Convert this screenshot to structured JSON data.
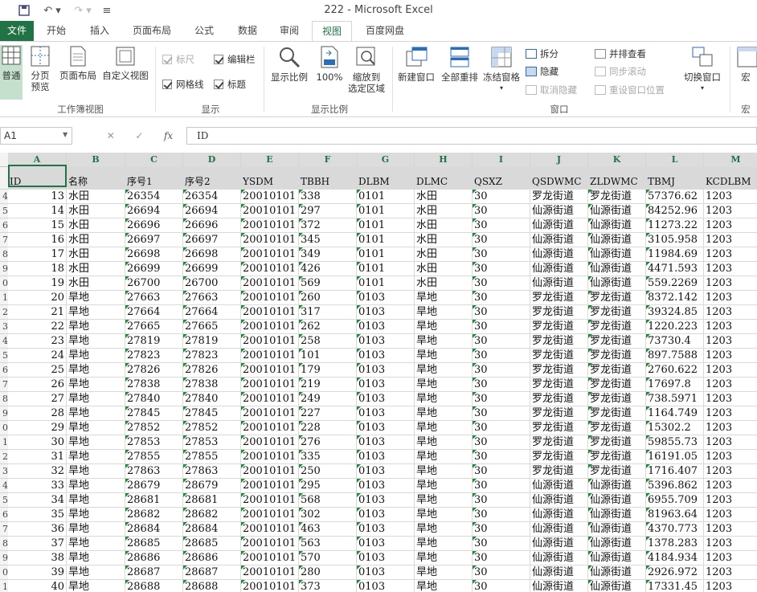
{
  "window": {
    "title": "222 - Microsoft Excel"
  },
  "quick_access": {
    "save_icon": "save-icon",
    "undo_icon": "undo-icon",
    "redo_icon": "redo-icon",
    "customize_icon": "customize-icon"
  },
  "tabs": [
    {
      "label": "文件"
    },
    {
      "label": "开始"
    },
    {
      "label": "插入"
    },
    {
      "label": "页面布局"
    },
    {
      "label": "公式"
    },
    {
      "label": "数据"
    },
    {
      "label": "审阅"
    },
    {
      "label": "视图"
    },
    {
      "label": "百度网盘"
    }
  ],
  "ribbon": {
    "normal": "普通",
    "page_break": "分页\n预览",
    "page_layout": "页面布局",
    "custom_view": "自定义视图",
    "group_workbook_views": "工作簿视图",
    "ruler": "标尺",
    "formula_bar": "编辑栏",
    "gridlines": "网格线",
    "headings": "标题",
    "group_show": "显示",
    "zoom": "显示比例",
    "zoom100": "100%",
    "zoom_selection": "缩放到\n选定区域",
    "group_zoom": "显示比例",
    "new_window": "新建窗口",
    "arrange_all": "全部重排",
    "freeze_panes": "冻结窗格",
    "split": "拆分",
    "hide": "隐藏",
    "unhide": "取消隐藏",
    "side_by_side": "并排查看",
    "sync_scroll": "同步滚动",
    "reset_position": "重设窗口位置",
    "switch_windows": "切换窗口",
    "group_window": "窗口",
    "macros": "宏",
    "group_macros": "宏"
  },
  "formula_bar": {
    "name_box": "A1",
    "fx": "fx",
    "value": "ID"
  },
  "columns": [
    "A",
    "B",
    "C",
    "D",
    "E",
    "F",
    "G",
    "H",
    "I",
    "J",
    "K",
    "L",
    "M"
  ],
  "header_row": [
    "ID",
    "名称",
    "序号1",
    "序号2",
    "YSDM",
    "TBBH",
    "DLBM",
    "DLMC",
    "QSXZ",
    "QSDWMC",
    "ZLDWMC",
    "TBMJ",
    "KCDLBM"
  ],
  "row_numbers": [
    "",
    "4",
    "5",
    "6",
    "7",
    "8",
    "9",
    "0",
    "1",
    "2",
    "3",
    "4",
    "5",
    "6",
    "7",
    "8",
    "9",
    "0",
    "1",
    "2",
    "3",
    "4",
    "5",
    "6",
    "7",
    "8",
    "9",
    "0",
    "1"
  ],
  "rows": [
    [
      "13",
      "水田",
      "26354",
      "26354",
      "20010101",
      "338",
      "0101",
      "水田",
      "30",
      "罗龙街道",
      "罗龙街道",
      "57376.62",
      "1203"
    ],
    [
      "14",
      "水田",
      "26694",
      "26694",
      "20010101",
      "297",
      "0101",
      "水田",
      "30",
      "仙源街道",
      "仙源街道",
      "84252.96",
      "1203"
    ],
    [
      "15",
      "水田",
      "26696",
      "26696",
      "20010101",
      "372",
      "0101",
      "水田",
      "30",
      "仙源街道",
      "仙源街道",
      "11273.22",
      "1203"
    ],
    [
      "16",
      "水田",
      "26697",
      "26697",
      "20010101",
      "345",
      "0101",
      "水田",
      "30",
      "仙源街道",
      "仙源街道",
      "3105.958",
      "1203"
    ],
    [
      "17",
      "水田",
      "26698",
      "26698",
      "20010101",
      "349",
      "0101",
      "水田",
      "30",
      "仙源街道",
      "仙源街道",
      "11984.69",
      "1203"
    ],
    [
      "18",
      "水田",
      "26699",
      "26699",
      "20010101",
      "426",
      "0101",
      "水田",
      "30",
      "仙源街道",
      "仙源街道",
      "4471.593",
      "1203"
    ],
    [
      "19",
      "水田",
      "26700",
      "26700",
      "20010101",
      "569",
      "0101",
      "水田",
      "30",
      "仙源街道",
      "仙源街道",
      "559.2269",
      "1203"
    ],
    [
      "20",
      "旱地",
      "27663",
      "27663",
      "20010101",
      "260",
      "0103",
      "旱地",
      "30",
      "罗龙街道",
      "罗龙街道",
      "8372.142",
      "1203"
    ],
    [
      "21",
      "旱地",
      "27664",
      "27664",
      "20010101",
      "317",
      "0103",
      "旱地",
      "30",
      "罗龙街道",
      "罗龙街道",
      "39324.85",
      "1203"
    ],
    [
      "22",
      "旱地",
      "27665",
      "27665",
      "20010101",
      "262",
      "0103",
      "旱地",
      "30",
      "罗龙街道",
      "罗龙街道",
      "1220.223",
      "1203"
    ],
    [
      "23",
      "旱地",
      "27819",
      "27819",
      "20010101",
      "258",
      "0103",
      "旱地",
      "30",
      "罗龙街道",
      "罗龙街道",
      "73730.4",
      "1203"
    ],
    [
      "24",
      "旱地",
      "27823",
      "27823",
      "20010101",
      "101",
      "0103",
      "旱地",
      "30",
      "罗龙街道",
      "罗龙街道",
      "897.7588",
      "1203"
    ],
    [
      "25",
      "旱地",
      "27826",
      "27826",
      "20010101",
      "179",
      "0103",
      "旱地",
      "30",
      "罗龙街道",
      "罗龙街道",
      "2760.622",
      "1203"
    ],
    [
      "26",
      "旱地",
      "27838",
      "27838",
      "20010101",
      "219",
      "0103",
      "旱地",
      "30",
      "罗龙街道",
      "罗龙街道",
      "17697.8",
      "1203"
    ],
    [
      "27",
      "旱地",
      "27840",
      "27840",
      "20010101",
      "249",
      "0103",
      "旱地",
      "30",
      "罗龙街道",
      "罗龙街道",
      "738.5971",
      "1203"
    ],
    [
      "28",
      "旱地",
      "27845",
      "27845",
      "20010101",
      "227",
      "0103",
      "旱地",
      "30",
      "罗龙街道",
      "罗龙街道",
      "1164.749",
      "1203"
    ],
    [
      "29",
      "旱地",
      "27852",
      "27852",
      "20010101",
      "228",
      "0103",
      "旱地",
      "30",
      "罗龙街道",
      "罗龙街道",
      "15302.2",
      "1203"
    ],
    [
      "30",
      "旱地",
      "27853",
      "27853",
      "20010101",
      "276",
      "0103",
      "旱地",
      "30",
      "罗龙街道",
      "罗龙街道",
      "59855.73",
      "1203"
    ],
    [
      "31",
      "旱地",
      "27855",
      "27855",
      "20010101",
      "335",
      "0103",
      "旱地",
      "30",
      "罗龙街道",
      "罗龙街道",
      "16191.05",
      "1203"
    ],
    [
      "32",
      "旱地",
      "27863",
      "27863",
      "20010101",
      "250",
      "0103",
      "旱地",
      "30",
      "罗龙街道",
      "罗龙街道",
      "1716.407",
      "1203"
    ],
    [
      "33",
      "旱地",
      "28679",
      "28679",
      "20010101",
      "295",
      "0103",
      "旱地",
      "30",
      "仙源街道",
      "仙源街道",
      "5396.862",
      "1203"
    ],
    [
      "34",
      "旱地",
      "28681",
      "28681",
      "20010101",
      "568",
      "0103",
      "旱地",
      "30",
      "仙源街道",
      "仙源街道",
      "6955.709",
      "1203"
    ],
    [
      "35",
      "旱地",
      "28682",
      "28682",
      "20010101",
      "302",
      "0103",
      "旱地",
      "30",
      "仙源街道",
      "仙源街道",
      "81963.64",
      "1203"
    ],
    [
      "36",
      "旱地",
      "28684",
      "28684",
      "20010101",
      "463",
      "0103",
      "旱地",
      "30",
      "仙源街道",
      "仙源街道",
      "4370.773",
      "1203"
    ],
    [
      "37",
      "旱地",
      "28685",
      "28685",
      "20010101",
      "563",
      "0103",
      "旱地",
      "30",
      "仙源街道",
      "仙源街道",
      "1378.283",
      "1203"
    ],
    [
      "38",
      "旱地",
      "28686",
      "28686",
      "20010101",
      "570",
      "0103",
      "旱地",
      "30",
      "仙源街道",
      "仙源街道",
      "4184.934",
      "1203"
    ],
    [
      "39",
      "旱地",
      "28687",
      "28687",
      "20010101",
      "280",
      "0103",
      "旱地",
      "30",
      "仙源街道",
      "仙源街道",
      "2926.972",
      "1203"
    ],
    [
      "40",
      "旱地",
      "28688",
      "28688",
      "20010101",
      "373",
      "0103",
      "旱地",
      "30",
      "仙源街道",
      "仙源街道",
      "17331.45",
      "1203"
    ]
  ],
  "colors": {
    "accent": "#217346",
    "indicator": "#1f8a3d"
  }
}
